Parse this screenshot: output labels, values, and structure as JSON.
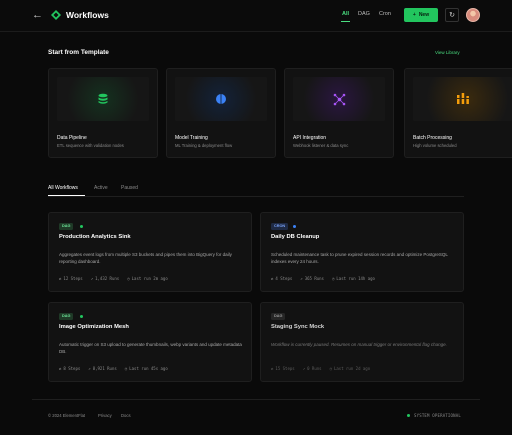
{
  "header": {
    "title": "Workflows",
    "nav": [
      "All",
      "DAG",
      "Cron"
    ],
    "new_label": "New"
  },
  "templates": {
    "heading": "Start from Template",
    "view_library": "View Library",
    "items": [
      {
        "title": "Data Pipeline",
        "desc": "ETL sequence with validation nodes",
        "icon": "database-icon",
        "color": "#22c55e"
      },
      {
        "title": "Model Training",
        "desc": "ML Training & deployment flow",
        "icon": "split-circle-icon",
        "color": "#3b82f6"
      },
      {
        "title": "API Integration",
        "desc": "Webhook listener & data sync",
        "icon": "network-icon",
        "color": "#a855f7"
      },
      {
        "title": "Batch Processing",
        "desc": "High volume scheduled",
        "icon": "bars-icon",
        "color": "#f59e0b"
      }
    ]
  },
  "tabs": [
    "All Workflows",
    "Active",
    "Paused"
  ],
  "workflows": [
    {
      "type": "DAG",
      "title": "Production Analytics Sink",
      "desc": "Aggregates event logs from multiple S3 buckets and pipes them into BigQuery for daily reporting dashboard.",
      "steps": "12 Steps",
      "runs": "1,432 Runs",
      "last": "Last run 2m ago",
      "status_color": "#22c55e"
    },
    {
      "type": "CRON",
      "title": "Daily DB Cleanup",
      "desc": "Scheduled maintenance task to prune expired session records and optimize PostgreSQL indexes every 24 hours.",
      "steps": "4 Steps",
      "runs": "365 Runs",
      "last": "Last run 14h ago",
      "status_color": "#3b82f6"
    },
    {
      "type": "DAG",
      "title": "Image Optimization Mesh",
      "desc": "Automatic trigger on S3 upload to generate thumbnails, webp variants and update metadata DB.",
      "steps": "8 Steps",
      "runs": "8,921 Runs",
      "last": "Last run 45s ago",
      "status_color": "#22c55e"
    },
    {
      "type": "DAG",
      "title": "Staging Sync Mock",
      "desc": "Workflow is currently paused. Resumes on manual trigger or environmental flag change.",
      "steps": "15 Steps",
      "runs": "0 Runs",
      "last": "Last run 2d ago",
      "status_color": ""
    }
  ],
  "footer": {
    "copyright": "© 2024 ElementFlat",
    "privacy": "Privacy",
    "docs": "Docs",
    "status": "SYSTEM OPERATIONAL"
  }
}
